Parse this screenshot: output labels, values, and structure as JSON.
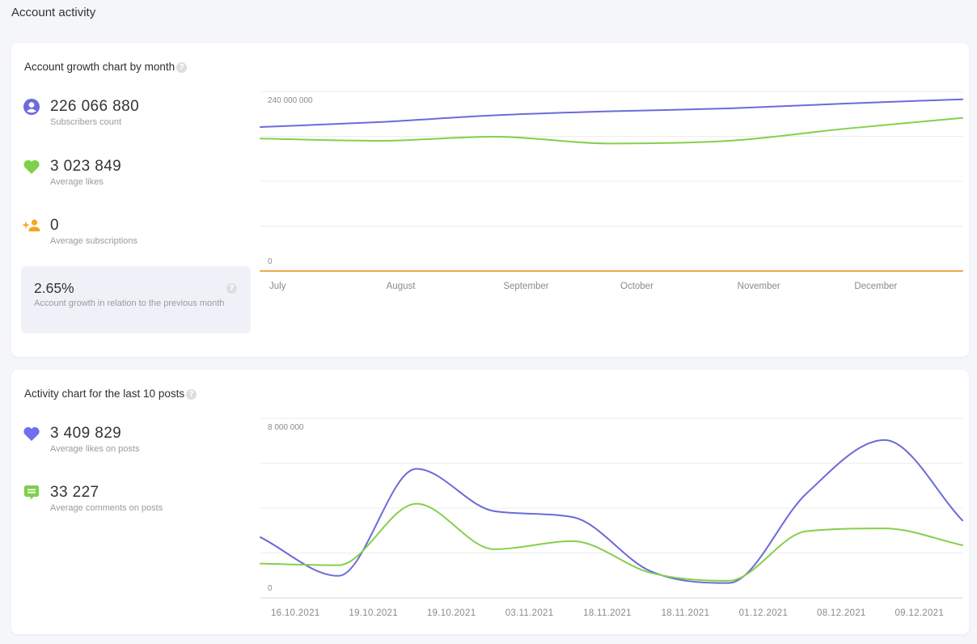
{
  "page": {
    "title": "Account activity"
  },
  "growth_card": {
    "title": "Account growth chart by month",
    "help_icon": "question-circle-icon",
    "stats": [
      {
        "icon": "user-circle-icon",
        "value": "226 066 880",
        "label": "Subscribers count",
        "color": "#6b6bdc"
      },
      {
        "icon": "heart-icon",
        "value": "3 023 849",
        "label": "Average likes",
        "color": "#7ed04b"
      },
      {
        "icon": "add-person-icon",
        "value": "0",
        "label": "Average subscriptions",
        "color": "#f5a623"
      }
    ],
    "growth": {
      "value": "2.65%",
      "label": "Account growth in relation to the previous month"
    }
  },
  "activity_card": {
    "title": "Activity chart for the last 10 posts",
    "help_icon": "question-circle-icon",
    "stats": [
      {
        "icon": "heart-icon",
        "value": "3 409 829",
        "label": "Average likes on posts",
        "color": "#6f6ff0"
      },
      {
        "icon": "comment-icon",
        "value": "33 227",
        "label": "Average comments on posts",
        "color": "#7ed04b"
      }
    ]
  },
  "chart_data": [
    {
      "type": "line",
      "title": "Account growth chart by month",
      "xlabel": "",
      "ylabel": "",
      "categories": [
        "July",
        "August",
        "September",
        "October",
        "November",
        "December"
      ],
      "ylim": [
        0,
        240000000
      ],
      "y2lim": [
        0,
        4000000
      ],
      "ytick_labels": [
        "240 000 000",
        "0"
      ],
      "grid": true,
      "legend": "left",
      "series": [
        {
          "name": "Subscribers count",
          "axis": "left",
          "color": "#6b6bd9",
          "values": [
            192400000,
            198900000,
            208100000,
            213500000,
            217300000,
            223800000,
            229500000
          ]
        },
        {
          "name": "Average likes",
          "axis": "right",
          "color": "#84d04c",
          "values": [
            2950000,
            2900000,
            2990000,
            2840000,
            2900000,
            3170000,
            3410000
          ]
        },
        {
          "name": "Average subscriptions",
          "axis": "left",
          "color": "#e9a94f",
          "values": [
            0,
            0,
            0,
            0,
            0,
            0,
            0
          ]
        }
      ]
    },
    {
      "type": "line",
      "title": "Activity chart for the last 10 posts",
      "xlabel": "",
      "ylabel": "",
      "categories": [
        "16.10.2021",
        "19.10.2021",
        "19.10.2021",
        "03.11.2021",
        "18.11.2021",
        "18.11.2021",
        "01.12.2021",
        "08.12.2021",
        "09.12.2021"
      ],
      "ylim": [
        0,
        8000000
      ],
      "y2lim": [
        0,
        120000
      ],
      "ytick_labels": [
        "8 000 000",
        "0"
      ],
      "grid": true,
      "legend": "left",
      "series": [
        {
          "name": "Average likes on posts",
          "axis": "left",
          "color": "#6a6ad8",
          "values": [
            2700000,
            980000,
            5750000,
            3860000,
            3600000,
            1190000,
            660000,
            4650000,
            7030000,
            3450000
          ]
        },
        {
          "name": "Average comments on posts",
          "axis": "right",
          "color": "#84d04c",
          "values": [
            22900,
            21800,
            62900,
            32500,
            37900,
            16800,
            11400,
            44500,
            46400,
            35200
          ]
        }
      ]
    }
  ]
}
